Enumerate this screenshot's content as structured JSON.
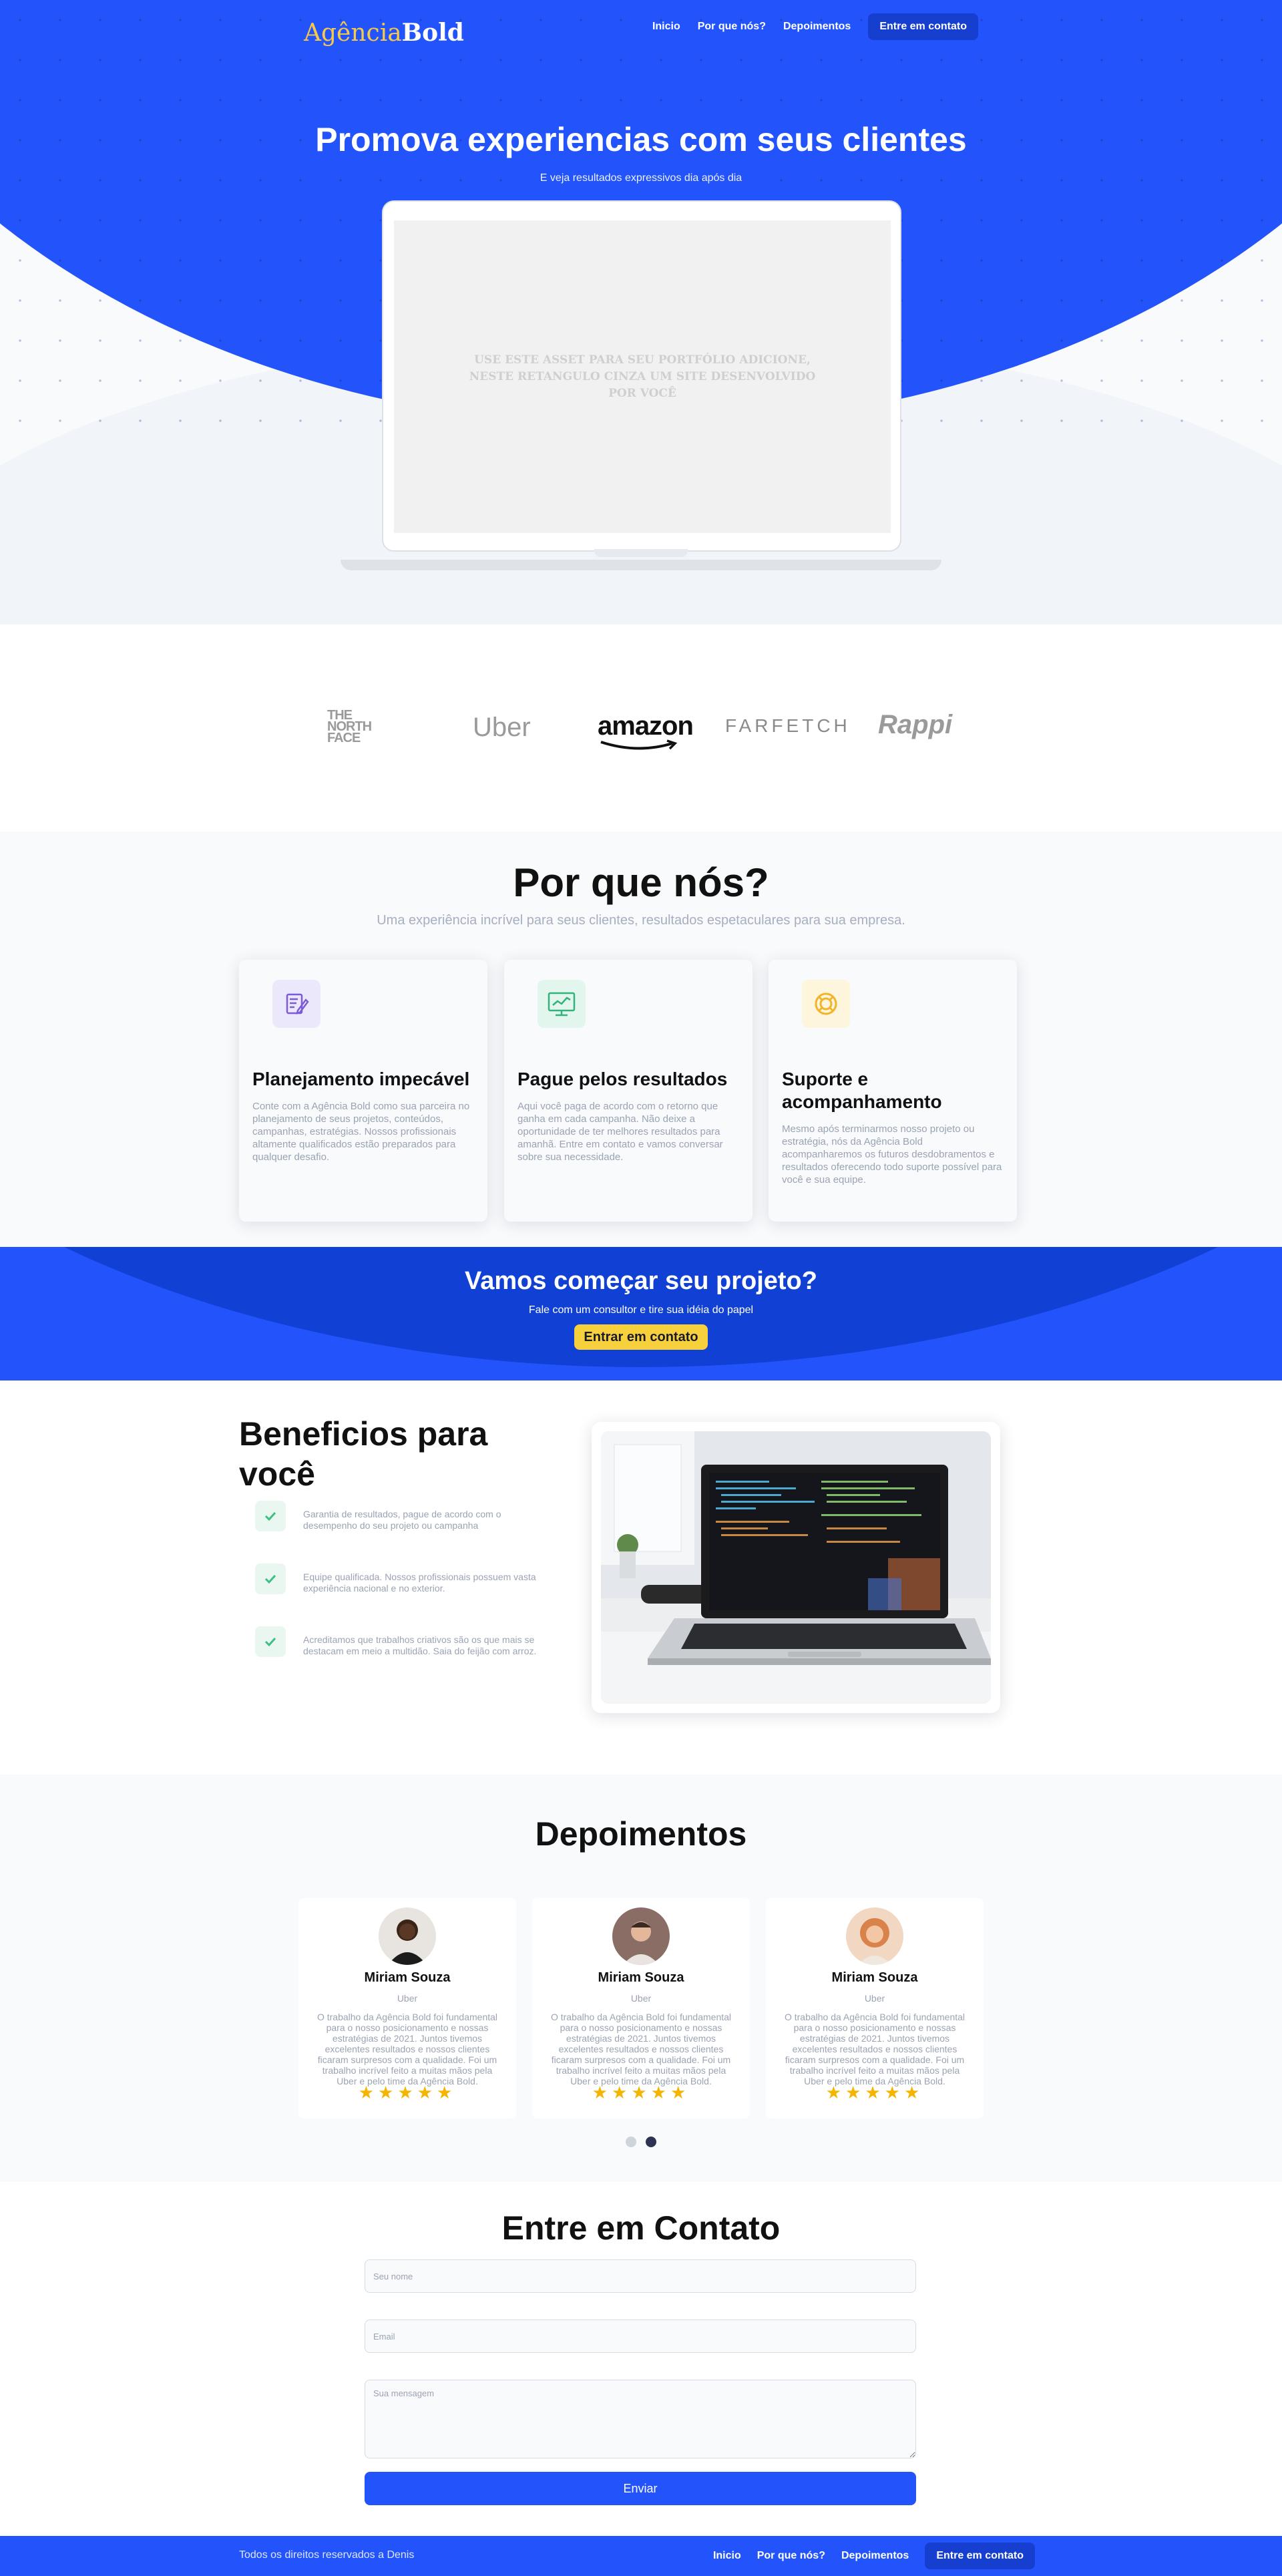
{
  "nav": {
    "logo_part1": "Agência",
    "logo_part2": "Bold",
    "links": [
      "Inicio",
      "Por que nós?",
      "Depoimentos"
    ],
    "cta": "Entre em contato"
  },
  "hero": {
    "title": "Promova experiencias com seus clientes",
    "subtitle": "E veja resultados expressivos dia após dia",
    "placeholder_text": "USE ESTE ASSET PARA SEU PORTFÓLIO ADICIONE, NESTE RETANGULO CINZA UM SITE DESENVOLVIDO POR VOCÊ"
  },
  "brands": [
    "THE NORTH FACE",
    "Uber",
    "amazon",
    "FARFETCH",
    "Rappi"
  ],
  "why": {
    "title": "Por que nós?",
    "subtitle": "Uma experiência incrível para seus clientes, resultados espetaculares para sua empresa.",
    "cards": [
      {
        "icon": "edit-icon",
        "title": "Planejamento impecável",
        "text": "Conte com a Agência Bold como sua parceira no planejamento de seus projetos, conteúdos, campanhas, estratégias. Nossos profissionais altamente qualificados estão preparados para qualquer desafio."
      },
      {
        "icon": "chart-monitor-icon",
        "title": "Pague pelos resultados",
        "text": "Aqui você paga de acordo com o retorno que ganha em cada campanha. Não deixe a oportunidade de ter melhores resultados para amanhã. Entre em contato e vamos conversar sobre sua necessidade."
      },
      {
        "icon": "support-ring-icon",
        "title": "Suporte e acompanhamento",
        "text": "Mesmo após terminarmos nosso projeto ou estratégia, nós da Agência Bold acompanharemos os futuros desdobramentos e resultados oferecendo todo suporte possível para você e sua equipe."
      }
    ]
  },
  "cta": {
    "title": "Vamos começar seu projeto?",
    "subtitle": "Fale com um consultor e tire sua idéia do papel",
    "button": "Entrar em contato"
  },
  "benefits": {
    "title": "Beneficios para você",
    "items": [
      "Garantia de resultados, pague de acordo com o desempenho do seu projeto ou campanha",
      "Equipe qualificada. Nossos profissionais possuem vasta experiência nacional e no exterior.",
      "Acreditamos que trabalhos criativos são os que mais se destacam em meio a multidão. Saia do feijão com arroz."
    ]
  },
  "testimonials": {
    "title": "Depoimentos",
    "items": [
      {
        "name": "Miriam Souza",
        "company": "Uber",
        "text": "O trabalho da Agência Bold foi fundamental para o nosso posicionamento e nossas estratégias de 2021. Juntos tivemos excelentes resultados e nossos clientes ficaram surpresos com a qualidade. Foi um trabalho incrível feito a muitas mãos pela Uber e pelo time da Agência Bold.",
        "stars": 5
      },
      {
        "name": "Miriam Souza",
        "company": "Uber",
        "text": "O trabalho da Agência Bold foi fundamental para o nosso posicionamento e nossas estratégias de 2021. Juntos tivemos excelentes resultados e nossos clientes ficaram surpresos com a qualidade. Foi um trabalho incrível feito a muitas mãos pela Uber e pelo time da Agência Bold.",
        "stars": 5
      },
      {
        "name": "Miriam Souza",
        "company": "Uber",
        "text": "O trabalho da Agência Bold foi fundamental para o nosso posicionamento e nossas estratégias de 2021. Juntos tivemos excelentes resultados e nossos clientes ficaram surpresos com a qualidade. Foi um trabalho incrível feito a muitas mãos pela Uber e pelo time da Agência Bold.",
        "stars": 5
      }
    ],
    "stars_glyph": "★★★★★",
    "active_page": 2,
    "page_count": 2
  },
  "contact": {
    "title": "Entre em Contato",
    "name_placeholder": "Seu nome",
    "email_placeholder": "Email",
    "message_placeholder": "Sua mensagem",
    "submit": "Enviar"
  },
  "footer": {
    "copyright": "Todos os direitos reservados a Denis",
    "links": [
      "Inicio",
      "Por que nós?",
      "Depoimentos"
    ],
    "cta": "Entre em contato"
  },
  "colors": {
    "primary": "#2354fb",
    "primary_dark": "#163fcf",
    "accent_yellow": "#f7d13c",
    "star": "#f5b400",
    "muted_text": "#9ba3b3"
  }
}
